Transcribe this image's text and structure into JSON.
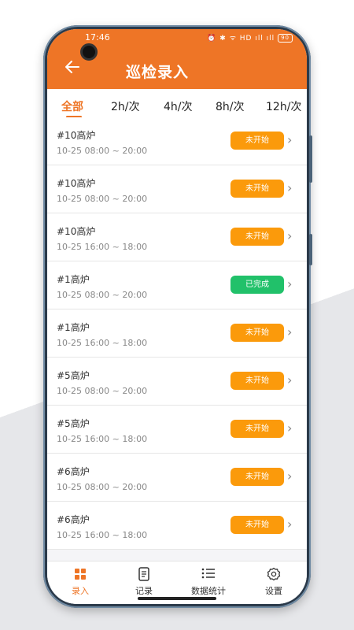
{
  "status_bar": {
    "time": "17:46",
    "icons": "⏰ ✱ ᯤ HD ıll ıll",
    "battery": "90"
  },
  "header": {
    "title": "巡检录入",
    "back_icon": "back-arrow-icon"
  },
  "tabs": [
    {
      "label": "全部",
      "active": true
    },
    {
      "label": "2h/次",
      "active": false
    },
    {
      "label": "4h/次",
      "active": false
    },
    {
      "label": "8h/次",
      "active": false
    },
    {
      "label": "12h/次",
      "active": false
    }
  ],
  "records": [
    {
      "name": "#10高炉",
      "time": "10-25 08:00 ~ 20:00",
      "status": "未开始"
    },
    {
      "name": "#10高炉",
      "time": "10-25 08:00 ~ 20:00",
      "status": "未开始"
    },
    {
      "name": "#10高炉",
      "time": "10-25 16:00 ~ 18:00",
      "status": "未开始"
    },
    {
      "name": "#1高炉",
      "time": "10-25 08:00 ~ 20:00",
      "status": "已完成"
    },
    {
      "name": "#1高炉",
      "time": "10-25 16:00 ~ 18:00",
      "status": "未开始"
    },
    {
      "name": "#5高炉",
      "time": "10-25 08:00 ~ 20:00",
      "status": "未开始"
    },
    {
      "name": "#5高炉",
      "time": "10-25 16:00 ~ 18:00",
      "status": "未开始"
    },
    {
      "name": "#6高炉",
      "time": "10-25 08:00 ~ 20:00",
      "status": "未开始"
    },
    {
      "name": "#6高炉",
      "time": "10-25 16:00 ~ 18:00",
      "status": "未开始"
    }
  ],
  "colors": {
    "accent": "#ee7526",
    "pending": "#fb9a0b",
    "done": "#21c16a"
  },
  "bottom_nav": [
    {
      "label": "录入",
      "icon": "grid-icon",
      "active": true
    },
    {
      "label": "记录",
      "icon": "document-icon",
      "active": false
    },
    {
      "label": "数据统计",
      "icon": "list-icon",
      "active": false
    },
    {
      "label": "设置",
      "icon": "gear-icon",
      "active": false
    }
  ]
}
